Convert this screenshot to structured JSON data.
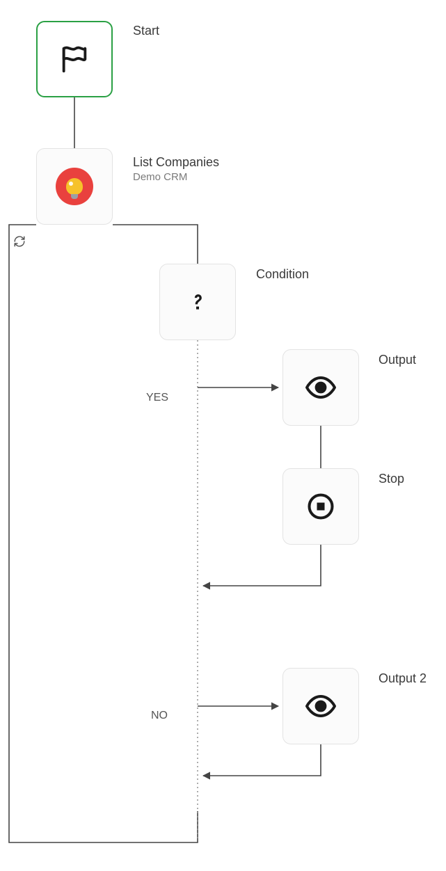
{
  "nodes": {
    "start": {
      "label": "Start"
    },
    "list": {
      "label": "List Companies",
      "sublabel": "Demo CRM"
    },
    "condition": {
      "label": "Condition"
    },
    "output": {
      "label": "Output"
    },
    "stop": {
      "label": "Stop"
    },
    "output2": {
      "label": "Output 2"
    }
  },
  "branches": {
    "yes": "YES",
    "no": "NO"
  },
  "colors": {
    "start_border": "#2aa044",
    "node_border": "#e3e3e3",
    "node_bg": "#fbfbfb",
    "crm_red": "#e9413e",
    "crm_yellow": "#f6c22a"
  }
}
